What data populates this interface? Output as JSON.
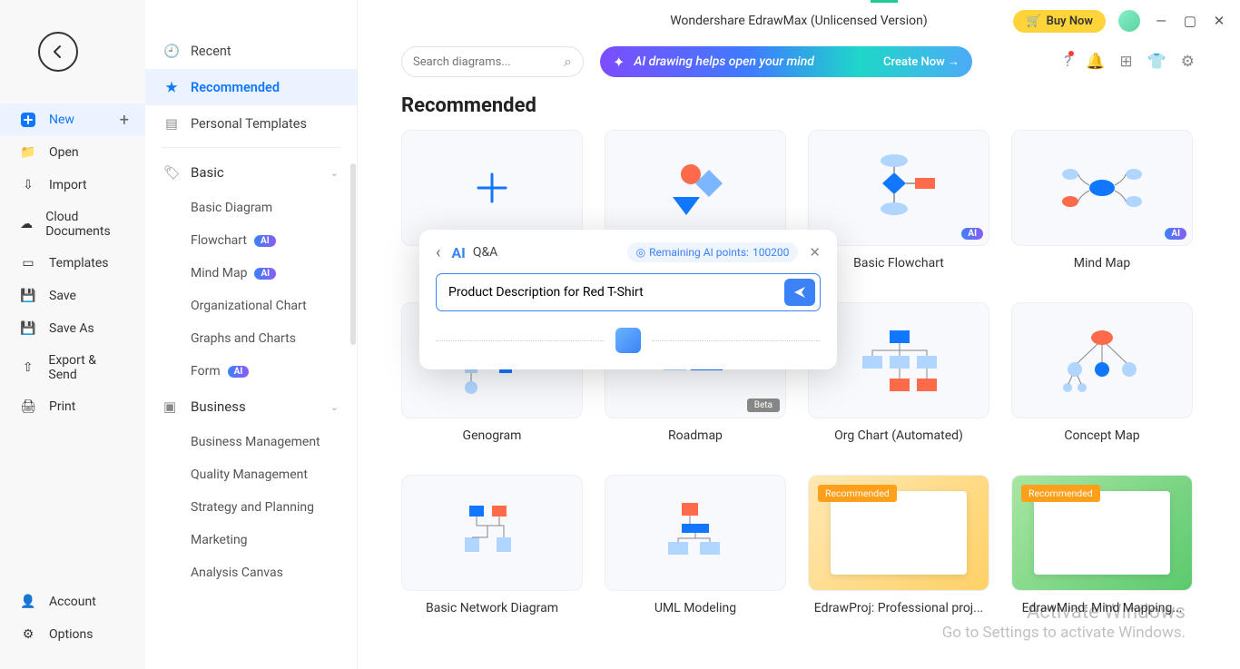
{
  "app_title": "Wondershare EdrawMax (Unlicensed Version)",
  "buy_now": "Buy Now",
  "leftnav": {
    "new": "New",
    "open": "Open",
    "import": "Import",
    "cloud": "Cloud Documents",
    "templates": "Templates",
    "save": "Save",
    "saveas": "Save As",
    "export": "Export & Send",
    "print": "Print",
    "account": "Account",
    "options": "Options"
  },
  "catnav": {
    "recent": "Recent",
    "recommended": "Recommended",
    "personal": "Personal Templates",
    "basic": {
      "title": "Basic",
      "items": [
        "Basic Diagram",
        "Flowchart",
        "Mind Map",
        "Organizational Chart",
        "Graphs and Charts",
        "Form"
      ]
    },
    "business": {
      "title": "Business",
      "items": [
        "Business Management",
        "Quality Management",
        "Strategy and Planning",
        "Marketing",
        "Analysis Canvas"
      ]
    }
  },
  "search_placeholder": "Search diagrams...",
  "ai_banner": {
    "text": "AI drawing helps open your mind",
    "cta": "Create Now →"
  },
  "section_title": "Recommended",
  "cards": [
    {
      "label": ""
    },
    {
      "label": ""
    },
    {
      "label": "Basic Flowchart"
    },
    {
      "label": "Mind Map"
    },
    {
      "label": "Genogram"
    },
    {
      "label": "Roadmap"
    },
    {
      "label": "Org Chart (Automated)"
    },
    {
      "label": "Concept Map"
    },
    {
      "label": "Basic Network Diagram"
    },
    {
      "label": "UML Modeling"
    },
    {
      "label": "EdrawProj: Professional proj..."
    },
    {
      "label": "EdrawMind: Mind Mapping..."
    }
  ],
  "ai_tag": "AI",
  "beta_tag": "Beta",
  "rec_tag": "Recommended",
  "qa": {
    "title": "Q&A",
    "points_label": "Remaining AI points:",
    "points_value": "100200",
    "input_value": "Product Description for Red T-Shirt"
  },
  "watermark": {
    "l1": "Activate Windows",
    "l2": "Go to Settings to activate Windows."
  }
}
